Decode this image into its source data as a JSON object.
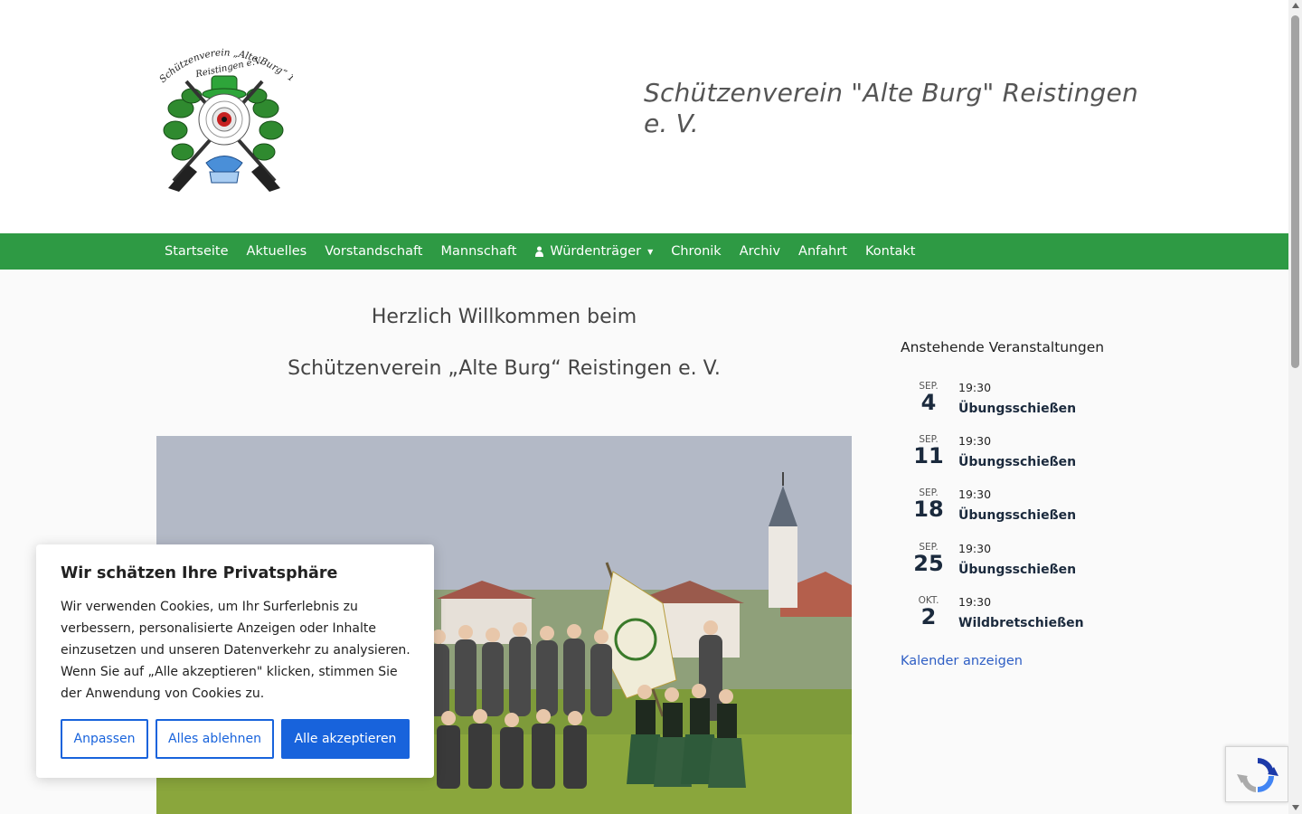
{
  "header": {
    "site_title": "Schützenverein \"Alte Burg\" Reistingen e. V.",
    "logo_text_top": "Schützenverein „Alte Burg“ 1906",
    "logo_text_sub": "Reistingen e.V."
  },
  "nav": {
    "items": [
      {
        "label": "Startseite"
      },
      {
        "label": "Aktuelles"
      },
      {
        "label": "Vorstandschaft"
      },
      {
        "label": "Mannschaft"
      },
      {
        "label": "Würdenträger",
        "icon": "person-icon",
        "has_dropdown": true
      },
      {
        "label": "Chronik"
      },
      {
        "label": "Archiv"
      },
      {
        "label": "Anfahrt"
      },
      {
        "label": "Kontakt"
      }
    ]
  },
  "main": {
    "welcome_line1": "Herzlich Willkommen beim",
    "welcome_line2": "Schützenverein „Alte Burg“ Reistingen e. V."
  },
  "sidebar": {
    "title": "Anstehende Veranstaltungen",
    "events": [
      {
        "month": "SEP.",
        "day": "4",
        "time": "19:30",
        "name": "Übungsschießen"
      },
      {
        "month": "SEP.",
        "day": "11",
        "time": "19:30",
        "name": "Übungsschießen"
      },
      {
        "month": "SEP.",
        "day": "18",
        "time": "19:30",
        "name": "Übungsschießen"
      },
      {
        "month": "SEP.",
        "day": "25",
        "time": "19:30",
        "name": "Übungsschießen"
      },
      {
        "month": "OKT.",
        "day": "2",
        "time": "19:30",
        "name": "Wildbretschießen"
      }
    ],
    "calendar_link": "Kalender anzeigen"
  },
  "cookie": {
    "title": "Wir schätzen Ihre Privatsphäre",
    "text": "Wir verwenden Cookies, um Ihr Surferlebnis zu verbessern, personalisierte Anzeigen oder Inhalte einzusetzen und unseren Datenverkehr zu analysieren. Wenn Sie auf „Alle akzeptieren\" klicken, stimmen Sie der Anwendung von Cookies zu.",
    "customize_label": "Anpassen",
    "reject_label": "Alles ablehnen",
    "accept_label": "Alle akzeptieren"
  },
  "colors": {
    "nav_bg": "#2e9a44",
    "accent_blue": "#1863dc",
    "link_blue": "#2e5ec4"
  }
}
